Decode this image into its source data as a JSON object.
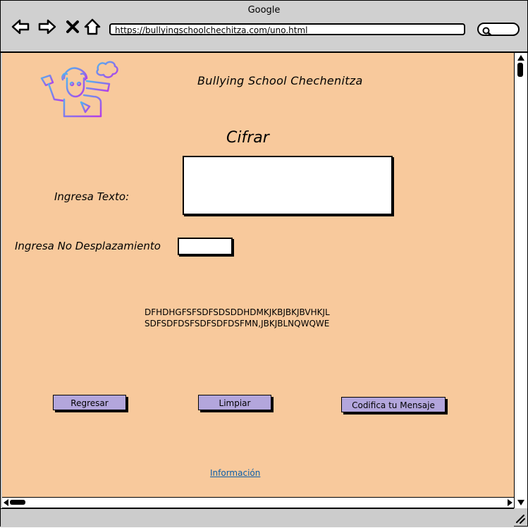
{
  "window": {
    "title": "Google"
  },
  "address_bar": {
    "url": "https://bullyingschoolchechitza.com/uno.html"
  },
  "icons": {
    "back": "back-arrow-icon",
    "forward": "forward-arrow-icon",
    "stop": "close-icon",
    "home": "home-icon",
    "search": "search-icon",
    "logo": "student-thinking-logo"
  },
  "header": {
    "site_title": "Bullying School Chechenitza"
  },
  "form": {
    "heading": "Cifrar",
    "text_label": "Ingresa Texto:",
    "text_value": "",
    "shift_label": "Ingresa No Desplazamiento",
    "shift_value": ""
  },
  "output": {
    "line1": "DFHDHGFSFSDFSDSDDHDMKJKBJBKJBVHKJL",
    "line2": "SDFSDFDSFSDFSDFDSFMN,JBKJBLNQWQWE"
  },
  "buttons": {
    "back": "Regresar",
    "clear": "Limpiar",
    "encode": "Codifica tu Mensaje"
  },
  "footer": {
    "info_link": "Información"
  },
  "colors": {
    "page_background": "#f8c99c",
    "button_fill": "#b3a6dc",
    "link": "#0a5ea8",
    "logo_gradient_start": "#4fb7f0",
    "logo_gradient_end": "#b63be8"
  }
}
